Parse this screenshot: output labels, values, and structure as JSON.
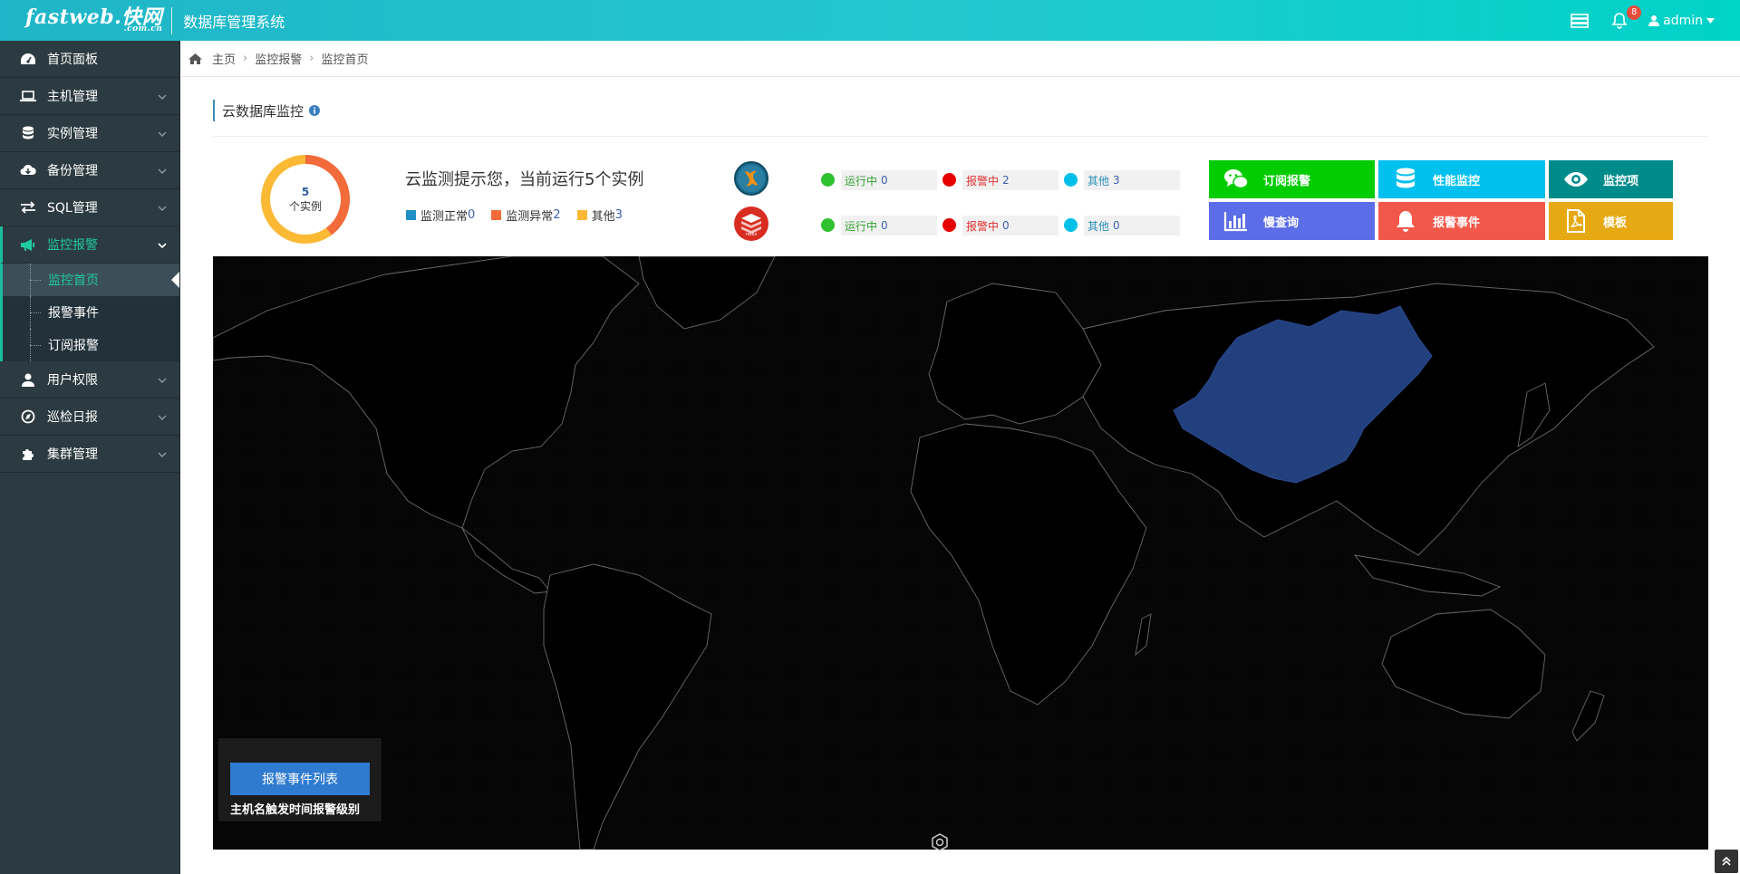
{
  "header": {
    "logo_text": "fastweb.快网",
    "logo_sub": ".com.cn",
    "app_title": "数据库管理系统",
    "notification_count": "8",
    "user": "admin",
    "icons": [
      "server-list-icon",
      "bell-icon",
      "user-icon",
      "caret-down-icon"
    ]
  },
  "sidebar": {
    "items": [
      {
        "label": "首页面板",
        "icon": "dashboard-icon"
      },
      {
        "label": "主机管理",
        "icon": "laptop-icon"
      },
      {
        "label": "实例管理",
        "icon": "database-icon"
      },
      {
        "label": "备份管理",
        "icon": "cloud-download-icon"
      },
      {
        "label": "SQL管理",
        "icon": "exchange-icon"
      },
      {
        "label": "监控报警",
        "icon": "bullhorn-icon",
        "active": true
      },
      {
        "label": "用户权限",
        "icon": "user-icon"
      },
      {
        "label": "巡检日报",
        "icon": "compass-icon"
      },
      {
        "label": "集群管理",
        "icon": "puzzle-icon"
      }
    ],
    "submenu": [
      {
        "label": "监控首页",
        "current": true
      },
      {
        "label": "报警事件"
      },
      {
        "label": "订阅报警"
      }
    ]
  },
  "breadcrumb": {
    "items": [
      "主页",
      "监控报警",
      "监控首页"
    ]
  },
  "section": {
    "title": "云数据库监控"
  },
  "summary": {
    "total": "5",
    "unit_label": "个实例",
    "tip_prefix": "云监测提示您，当前运行",
    "tip_count": "5",
    "tip_suffix": "个实例",
    "legend": [
      {
        "label": "监测正常",
        "value": "0",
        "color": "#1f8fc6"
      },
      {
        "label": "监测异常",
        "value": "2",
        "color": "#f26b3a"
      },
      {
        "label": "其他",
        "value": "3",
        "color": "#fbb934"
      }
    ],
    "donut_segments": [
      {
        "name": "监测异常",
        "value": 2,
        "color": "#f26b3a"
      },
      {
        "name": "其他",
        "value": 3,
        "color": "#fbb934"
      }
    ]
  },
  "db_status": [
    {
      "db": "MySQL",
      "icon": "mysql-logo-icon",
      "running": {
        "label": "运行中",
        "value": "0",
        "color": "#2fc12f"
      },
      "alarm": {
        "label": "报警中",
        "value": "2",
        "color": "#e60000"
      },
      "other": {
        "label": "其他",
        "value": "3",
        "color": "#00bfe8"
      }
    },
    {
      "db": "Redis",
      "icon": "redis-logo-icon",
      "running": {
        "label": "运行中",
        "value": "0",
        "color": "#2fc12f"
      },
      "alarm": {
        "label": "报警中",
        "value": "0",
        "color": "#e60000"
      },
      "other": {
        "label": "其他",
        "value": "0",
        "color": "#00bfe8"
      }
    }
  ],
  "tiles": [
    {
      "label": "订阅报警",
      "color": "#00cc00",
      "icon": "wechat-icon"
    },
    {
      "label": "性能监控",
      "color": "#00c0ef",
      "icon": "database-icon"
    },
    {
      "label": "监控项",
      "color": "#008b8b",
      "icon": "eye-icon"
    },
    {
      "label": "慢查询",
      "color": "#5b6de8",
      "icon": "bar-chart-icon"
    },
    {
      "label": "报警事件",
      "color": "#f2584a",
      "icon": "bell-icon"
    },
    {
      "label": "模板",
      "color": "#e6a913",
      "icon": "pdf-file-icon"
    }
  ],
  "map": {
    "highlight_country": "China",
    "highlight_color": "#223f7e",
    "alarm_list_button": "报警事件列表",
    "alarm_list_header": "主机名触发时间报警级别"
  }
}
